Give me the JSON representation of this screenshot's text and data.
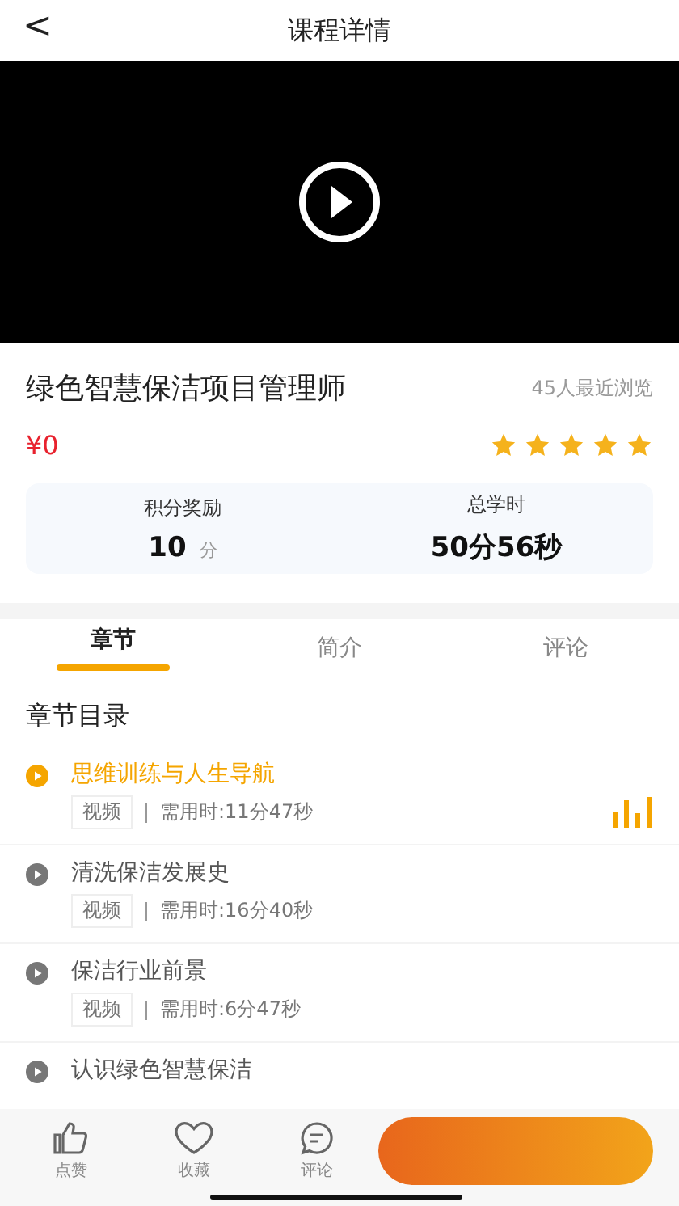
{
  "header": {
    "back": "<",
    "title": "课程详情"
  },
  "course": {
    "title": "绿色智慧保洁项目管理师",
    "views": "45人最近浏览",
    "price": "¥0",
    "stars": 5,
    "stats": [
      {
        "label": "积分奖励",
        "value": "10",
        "unit": "分"
      },
      {
        "label": "总学时",
        "value": "50分56秒"
      }
    ]
  },
  "tabs": [
    {
      "label": "章节",
      "selected": true
    },
    {
      "label": "简介",
      "selected": false
    },
    {
      "label": "评论",
      "selected": false
    }
  ],
  "section_title": "章节目录",
  "chapters": [
    {
      "title": "思维训练与人生导航",
      "tag": "视频",
      "duration": "需用时:11分47秒",
      "selected": true
    },
    {
      "title": "清洗保洁发展史",
      "tag": "视频",
      "duration": "需用时:16分40秒",
      "selected": false
    },
    {
      "title": "保洁行业前景",
      "tag": "视频",
      "duration": "需用时:6分47秒",
      "selected": false
    },
    {
      "title": "认识绿色智慧保洁",
      "selected": false
    }
  ],
  "bottom_bar": [
    {
      "kind": "like",
      "label": "点赞"
    },
    {
      "kind": "favorite",
      "label": "收藏"
    },
    {
      "kind": "comment",
      "label": "评论"
    }
  ]
}
